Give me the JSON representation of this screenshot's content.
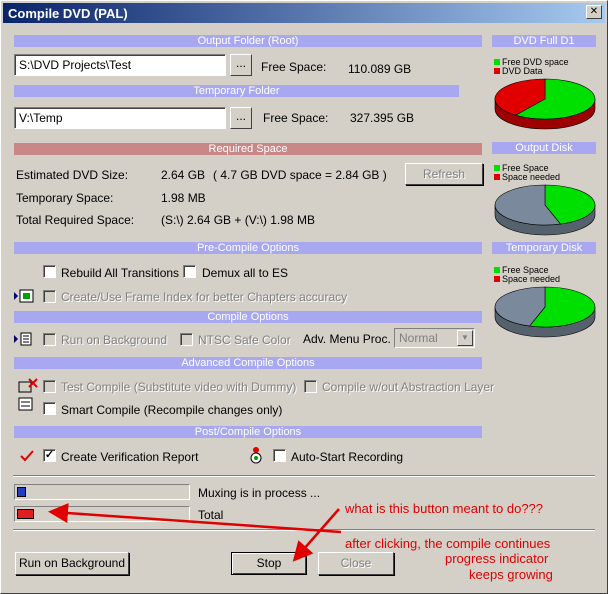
{
  "window": {
    "title": "Compile DVD (PAL)",
    "close_glyph": "✕"
  },
  "output_folder": {
    "header": "Output Folder (Root)",
    "path": "S:\\DVD Projects\\Test",
    "free_label": "Free Space:",
    "free_value": "110.089 GB",
    "browse": "..."
  },
  "temp_folder": {
    "header": "Temporary Folder",
    "path": "V:\\Temp",
    "free_label": "Free Space:",
    "free_value": "327.395 GB",
    "browse": "..."
  },
  "required": {
    "header": "Required Space",
    "est_label": "Estimated DVD Size:",
    "est_value": "2.64 GB",
    "est_note": "( 4.7 GB DVD space = 2.84 GB )",
    "temp_label": "Temporary Space:",
    "temp_value": "1.98 MB",
    "total_label": "Total Required Space:",
    "total_value": "(S:\\) 2.64 GB + (V:\\) 1.98 MB",
    "refresh": "Refresh"
  },
  "precompile": {
    "header": "Pre-Compile Options",
    "rebuild": "Rebuild All Transitions",
    "demux": "Demux all to ES",
    "frame_index": "Create/Use Frame Index for better Chapters accuracy"
  },
  "compile": {
    "header": "Compile Options",
    "run_bg": "Run on Background",
    "ntsc": "NTSC Safe Color",
    "adv_menu_label": "Adv. Menu Proc.",
    "adv_menu_value": "Normal"
  },
  "advanced": {
    "header": "Advanced Compile Options",
    "test_compile": "Test Compile (Substitute video with Dummy)",
    "no_abstraction": "Compile w/out Abstraction Layer",
    "smart_compile": "Smart Compile (Recompile changes only)"
  },
  "post": {
    "header": "Post/Compile Options",
    "verification": "Create Verification Report",
    "auto_start": "Auto-Start Recording",
    "check_glyph": "✓"
  },
  "charts": {
    "dvd": {
      "header": "DVD Full D1",
      "legend": [
        "Free DVD space",
        "DVD Data"
      ],
      "values": [
        0.6,
        0.4
      ],
      "colors": [
        "#00e000",
        "#e00000"
      ]
    },
    "output": {
      "header": "Output Disk",
      "legend": [
        "Free Space",
        "Space needed"
      ],
      "values": [
        0.45,
        0.55
      ],
      "colors": [
        "#00e000",
        "#7a8a9c"
      ]
    },
    "temp": {
      "header": "Temporary Disk",
      "legend": [
        "Free Space",
        "Space needed"
      ],
      "values": [
        0.55,
        0.45
      ],
      "colors": [
        "#00e000",
        "#7a8a9c"
      ]
    }
  },
  "progress": {
    "muxing_label": "Muxing is in process ...",
    "muxing_value": 0.05,
    "total_label": "Total",
    "total_value": 0.1
  },
  "buttons": {
    "run_bg": "Run on Background",
    "stop": "Stop",
    "close": "Close"
  },
  "annotations": {
    "q1": "what is this button meant to do???",
    "q2": "after clicking, the compile continues",
    "q3": "progress indicator",
    "q4": "keeps growing"
  }
}
